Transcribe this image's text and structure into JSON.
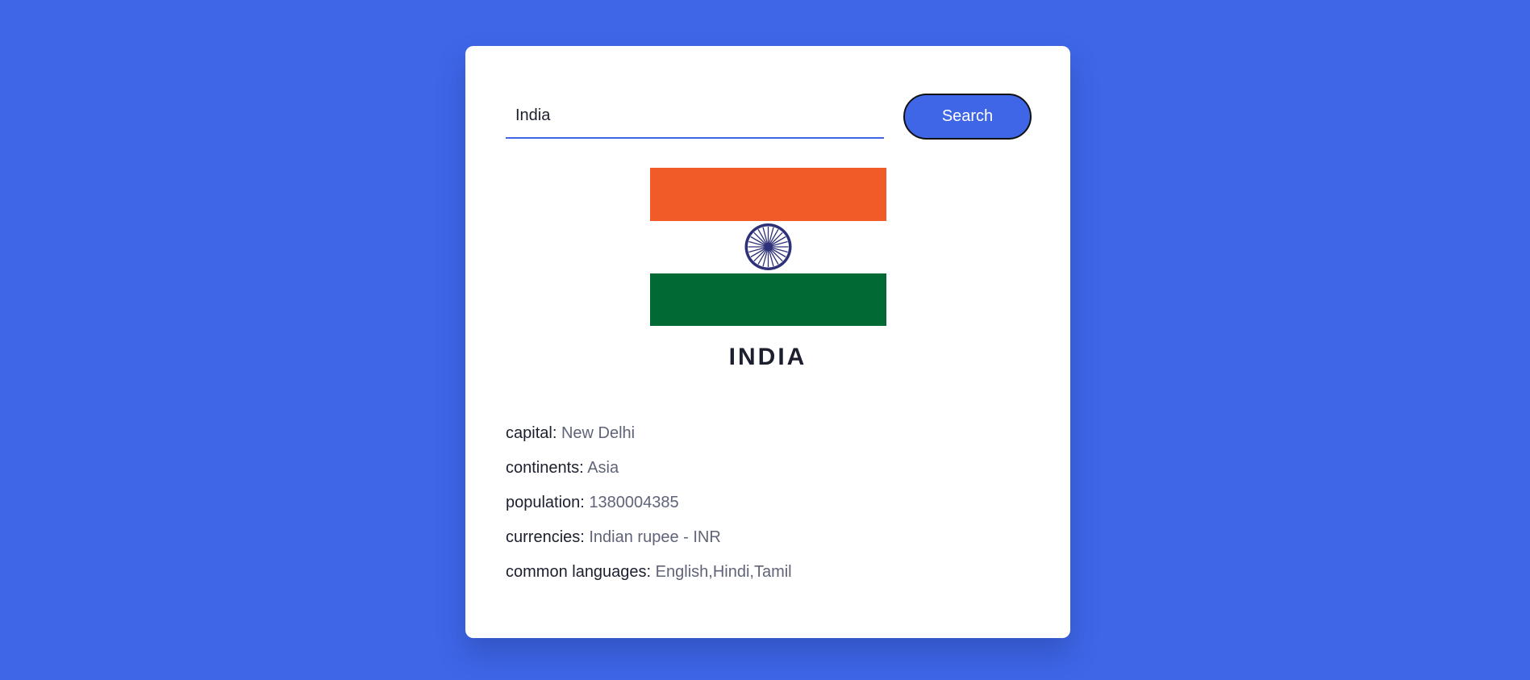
{
  "search": {
    "value": "India",
    "button_label": "Search"
  },
  "country": {
    "name": "INDIA",
    "flag": {
      "icon": "india-flag",
      "colors": {
        "saffron": "#f15b27",
        "white": "#ffffff",
        "green": "#016a34",
        "chakra": "#2e3178"
      }
    }
  },
  "details": [
    {
      "label": "capital:",
      "value": "New Delhi"
    },
    {
      "label": "continents:",
      "value": "Asia"
    },
    {
      "label": "population:",
      "value": "1380004385"
    },
    {
      "label": "currencies:",
      "value": "Indian rupee - INR"
    },
    {
      "label": "common languages:",
      "value": "English,Hindi,Tamil"
    }
  ],
  "theme": {
    "accent": "#3e66e7",
    "card_background": "#ffffff"
  }
}
